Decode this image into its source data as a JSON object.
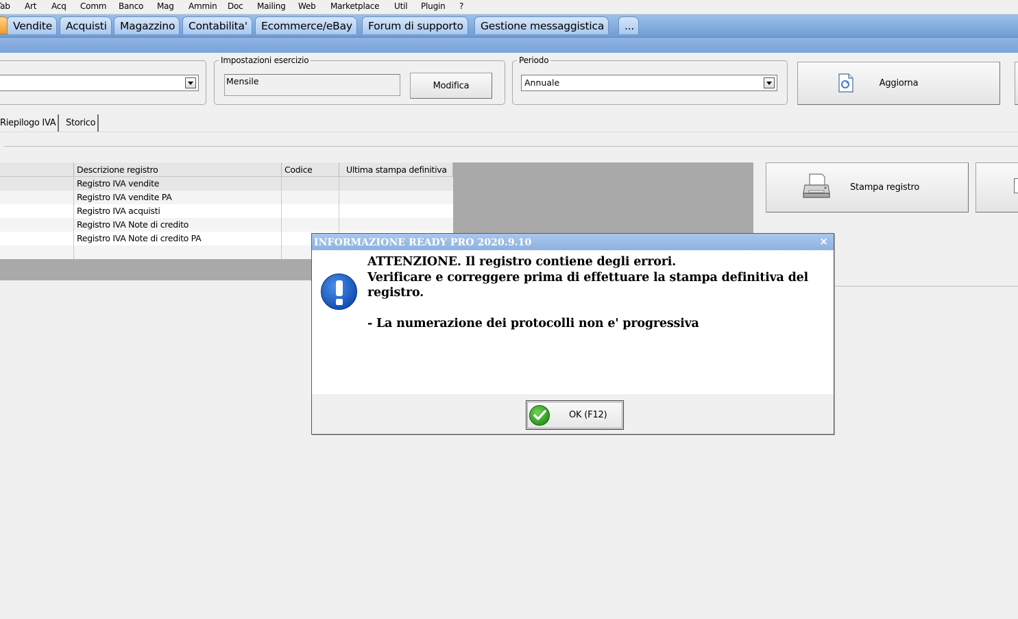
{
  "menubar": [
    "Tab",
    "Art",
    "Acq",
    "Comm",
    "Banco",
    "Mag",
    "Ammin",
    "Doc",
    "Mailing",
    "Web",
    "Marketplace",
    "Util",
    "Plugin",
    "?"
  ],
  "module_tabs": [
    "Vendite",
    "Acquisti",
    "Magazzino",
    "Contabilita'",
    "Ecommerce/eBay",
    "Forum di supporto",
    "Gestione messaggistica",
    "..."
  ],
  "settings": {
    "label": "Impostazioni esercizio",
    "value": "Mensile",
    "modify_button": "Modifica"
  },
  "period": {
    "label": "Periodo",
    "value": "Annuale"
  },
  "refresh_button": "Aggiorna",
  "subtabs": [
    "Riepilogo IVA",
    "Storico"
  ],
  "grid": {
    "columns": [
      "Descrizione registro",
      "Codice",
      "Ultima stampa definitiva"
    ],
    "rows": [
      {
        "descrizione": "Registro IVA vendite",
        "codice": "",
        "ultima": ""
      },
      {
        "descrizione": "Registro IVA vendite PA",
        "codice": "",
        "ultima": ""
      },
      {
        "descrizione": "Registro IVA acquisti",
        "codice": "",
        "ultima": ""
      },
      {
        "descrizione": "Registro IVA Note di credito",
        "codice": "",
        "ultima": ""
      },
      {
        "descrizione": "Registro IVA Note di credito PA",
        "codice": "",
        "ultima": ""
      }
    ]
  },
  "print_button": "Stampa registro",
  "dialog": {
    "title": "INFORMAZIONE READY PRO 2020.9.10",
    "close": "×",
    "line1": "ATTENZIONE. Il registro contiene degli errori.",
    "line2": "Verificare e correggere prima di effettuare la stampa definitiva del registro.",
    "line3": "- La numerazione dei protocolli non e' progressiva",
    "ok_button": "OK (F12)"
  },
  "colors": {
    "tab_band": "#7aa3d8",
    "dialog_title": "#9bbde8",
    "info_icon": "#1452b8",
    "ok_icon": "#2c9a1d"
  },
  "icons": [
    "dropdown-arrow-icon",
    "refresh-icon",
    "printer-icon",
    "info-icon",
    "checkmark-icon",
    "close-icon"
  ]
}
